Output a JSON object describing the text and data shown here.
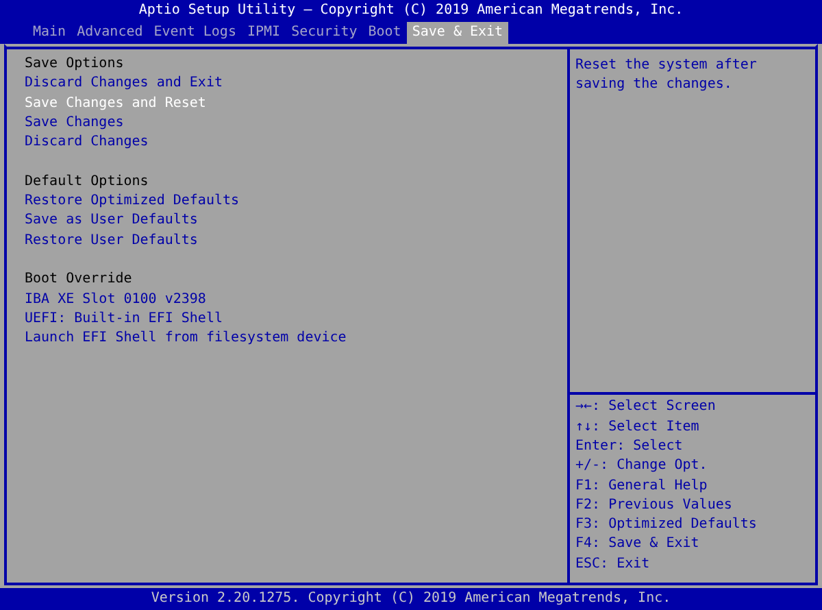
{
  "window": {
    "title": "Aptio Setup Utility – Copyright (C) 2019 American Megatrends, Inc."
  },
  "tabs": [
    {
      "label": "Main",
      "selected": false
    },
    {
      "label": "Advanced",
      "selected": false
    },
    {
      "label": "Event Logs",
      "selected": false
    },
    {
      "label": "IPMI",
      "selected": false
    },
    {
      "label": "Security",
      "selected": false
    },
    {
      "label": "Boot",
      "selected": false
    },
    {
      "label": "Save & Exit",
      "selected": true
    }
  ],
  "sections": [
    {
      "heading": "Save Options",
      "items": [
        {
          "label": "Discard Changes and Exit",
          "selected": false
        },
        {
          "label": "Save Changes and Reset",
          "selected": true
        },
        {
          "label": "Save Changes",
          "selected": false
        },
        {
          "label": "Discard Changes",
          "selected": false
        }
      ]
    },
    {
      "heading": "Default Options",
      "items": [
        {
          "label": "Restore Optimized Defaults",
          "selected": false
        },
        {
          "label": "Save as User Defaults",
          "selected": false
        },
        {
          "label": "Restore User Defaults",
          "selected": false
        }
      ]
    },
    {
      "heading": "Boot Override",
      "items": [
        {
          "label": "IBA XE Slot 0100 v2398",
          "selected": false
        },
        {
          "label": "UEFI: Built-in EFI Shell",
          "selected": false
        },
        {
          "label": "Launch EFI Shell from filesystem device",
          "selected": false
        }
      ]
    }
  ],
  "help": {
    "text": "Reset the system after saving the changes."
  },
  "keys": [
    "→←: Select Screen",
    "↑↓: Select Item",
    "Enter: Select",
    "+/-: Change Opt.",
    "F1: General Help",
    "F2: Previous Values",
    "F3: Optimized Defaults",
    "F4: Save & Exit",
    "ESC: Exit"
  ],
  "status_bar": "Version 2.20.1275. Copyright (C) 2019 American Megatrends, Inc."
}
